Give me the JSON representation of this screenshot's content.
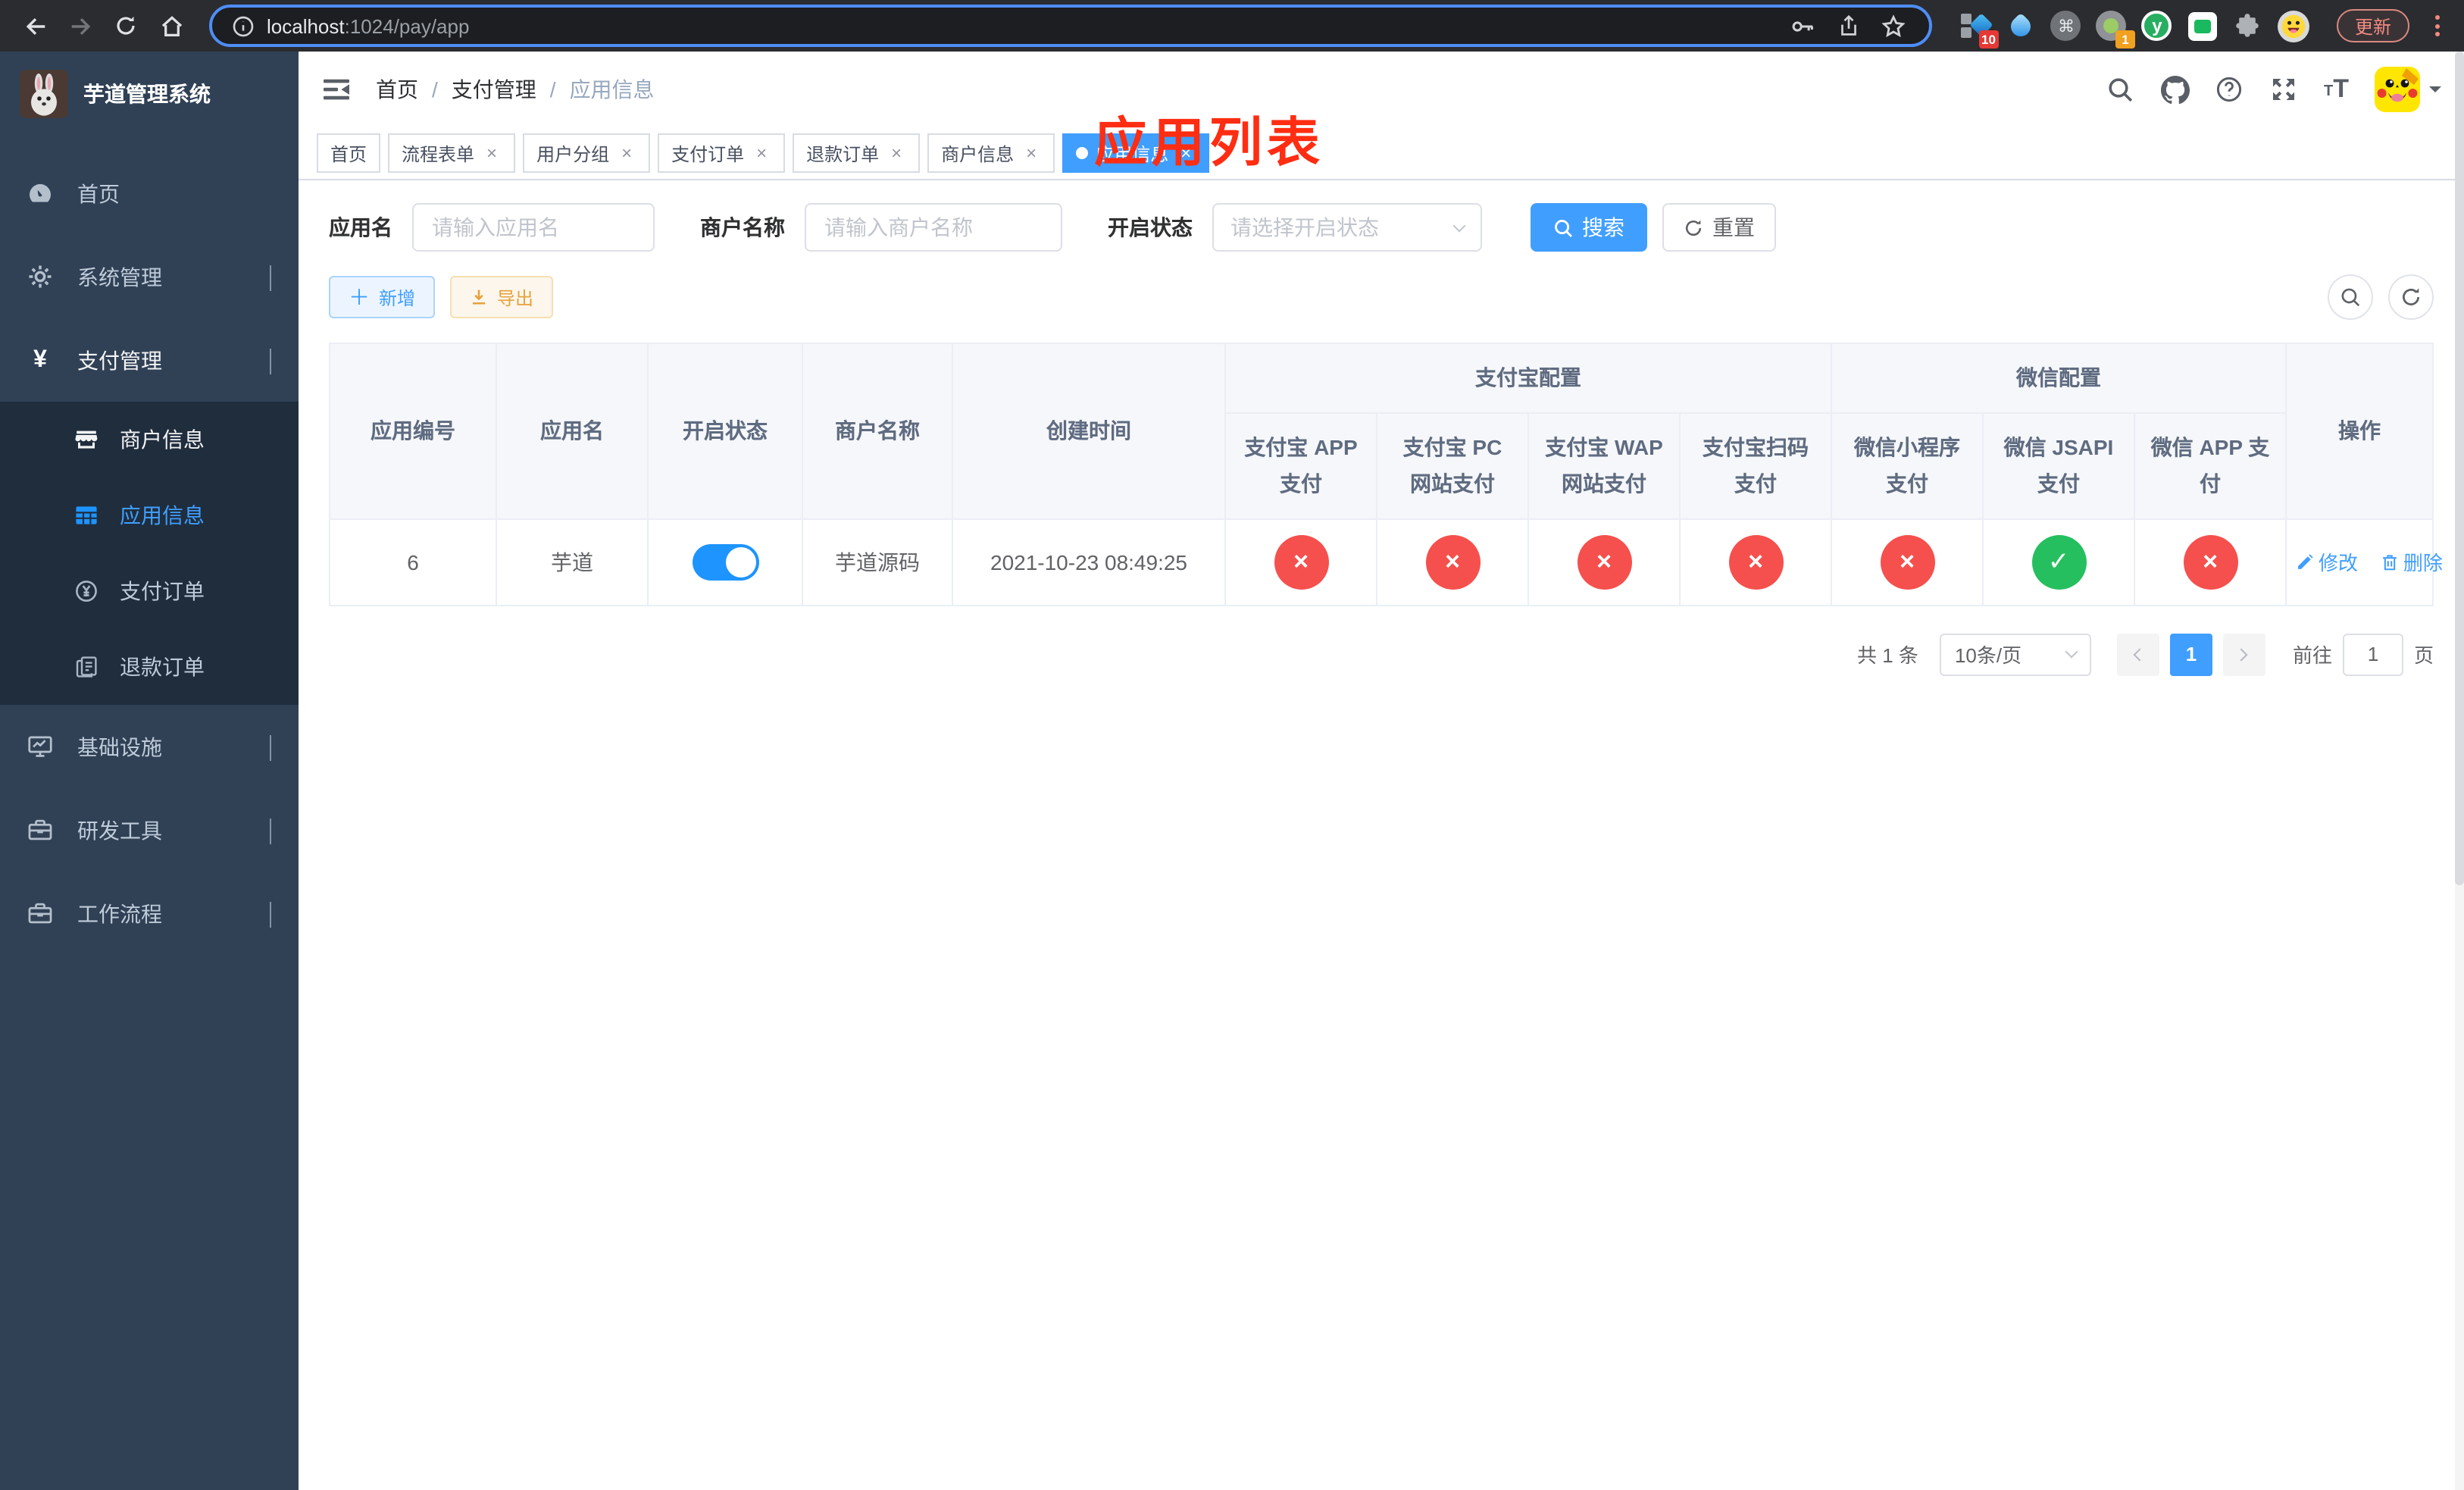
{
  "browser": {
    "url_host": "localhost",
    "url_path": ":1024/pay/app",
    "update_label": "更新",
    "ext_badge_10": "10",
    "ext_badge_1": "1",
    "ext_y_label": "y",
    "ext_cmd_glyph": "⌘"
  },
  "sidebar": {
    "title": "芋道管理系统",
    "menu": [
      {
        "label": "首页"
      },
      {
        "label": "系统管理"
      },
      {
        "label": "支付管理"
      },
      {
        "label": "基础设施"
      },
      {
        "label": "研发工具"
      },
      {
        "label": "工作流程"
      }
    ],
    "submenu": [
      {
        "label": "商户信息"
      },
      {
        "label": "应用信息"
      },
      {
        "label": "支付订单"
      },
      {
        "label": "退款订单"
      }
    ]
  },
  "navbar": {
    "breadcrumb": [
      "首页",
      "支付管理",
      "应用信息"
    ],
    "separator": "/"
  },
  "annotation": {
    "text": "应用列表"
  },
  "tabs": [
    {
      "label": "首页"
    },
    {
      "label": "流程表单"
    },
    {
      "label": "用户分组"
    },
    {
      "label": "支付订单"
    },
    {
      "label": "退款订单"
    },
    {
      "label": "商户信息"
    },
    {
      "label": "应用信息"
    }
  ],
  "filters": {
    "app_name_label": "应用名",
    "app_name_placeholder": "请输入应用名",
    "merchant_label": "商户名称",
    "merchant_placeholder": "请输入商户名称",
    "status_label": "开启状态",
    "status_placeholder": "请选择开启状态",
    "search_label": "搜索",
    "reset_label": "重置"
  },
  "toolbar": {
    "add_label": "新增",
    "export_label": "导出"
  },
  "table": {
    "groups": {
      "alipay": "支付宝配置",
      "wechat": "微信配置"
    },
    "columns": {
      "id": "应用编号",
      "name": "应用名",
      "status": "开启状态",
      "merchant": "商户名称",
      "created": "创建时间",
      "alipay_app": "支付宝 APP 支付",
      "alipay_pc": "支付宝 PC 网站支付",
      "alipay_wap": "支付宝 WAP 网站支付",
      "alipay_scan": "支付宝扫码支付",
      "wx_mini": "微信小程序支付",
      "wx_jsapi": "微信 JSAPI 支付",
      "wx_app": "微信 APP 支付",
      "actions": "操作"
    },
    "row": {
      "id": "6",
      "name": "芋道",
      "status_on": true,
      "merchant": "芋道源码",
      "created": "2021-10-23 08:49:25",
      "channels": [
        {
          "name": "alipay-app-pay",
          "enabled": false
        },
        {
          "name": "alipay-pc-pay",
          "enabled": false
        },
        {
          "name": "alipay-wap-pay",
          "enabled": false
        },
        {
          "name": "alipay-scan-pay",
          "enabled": false
        },
        {
          "name": "wechat-mini-pay",
          "enabled": false
        },
        {
          "name": "wechat-jsapi-pay",
          "enabled": true
        },
        {
          "name": "wechat-app-pay",
          "enabled": false
        }
      ],
      "edit_label": "修改",
      "delete_label": "删除"
    }
  },
  "pagination": {
    "total": "共 1 条",
    "page_size": "10条/页",
    "page": "1",
    "goto": "前往",
    "goto_value": "1",
    "unit": "页"
  },
  "colors": {
    "primary": "#409EFF",
    "toggle_on": "#1d94ff",
    "circle_green": "#26bf5f",
    "circle_red": "#f5504d",
    "annotation_red": "#ff2d12",
    "sidebar_bg": "#304156",
    "submenu_bg": "#1f2d3d",
    "export_text": "#e6a23c"
  },
  "icons": {
    "browser": [
      "back-icon",
      "forward-icon",
      "reload-icon",
      "home-icon",
      "info-icon",
      "key-icon",
      "share-icon",
      "star-icon",
      "puzzle-icon",
      "menu-dots-icon"
    ],
    "navbar": [
      "hamburger-icon",
      "search-icon",
      "github-icon",
      "help-icon",
      "fullscreen-icon",
      "font-size-icon",
      "caret-down-icon"
    ],
    "sidebar": [
      "dashboard-icon",
      "gear-icon",
      "yen-icon",
      "shop-icon",
      "grid-icon",
      "coin-icon",
      "refund-doc-icon",
      "monitor-icon",
      "toolbox-icon"
    ],
    "actions": [
      "plus-icon",
      "download-icon",
      "search-icon",
      "refresh-icon",
      "edit-pen-icon",
      "delete-trash-icon"
    ]
  }
}
